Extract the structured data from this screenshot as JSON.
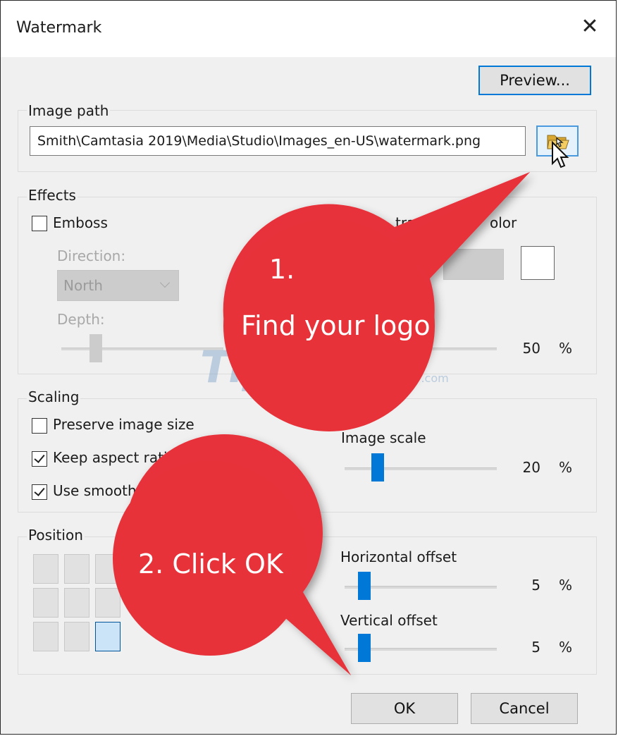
{
  "window": {
    "title": "Watermark",
    "close_glyph": "✕"
  },
  "toolbar": {
    "preview_label": "Preview..."
  },
  "image_path": {
    "group_label": "Image path",
    "value": "Smith\\Camtasia 2019\\Media\\Studio\\Images_en-US\\watermark.png",
    "browse_icon": "folder-open-icon"
  },
  "effects": {
    "group_label": "Effects",
    "emboss_label": "Emboss",
    "emboss_checked": false,
    "direction_label": "Direction:",
    "direction_value": "North",
    "depth_label": "Depth:",
    "transparent_color_label_visible": "trans",
    "transparent_color_label_visible_2": "olor",
    "opacity_value": "50",
    "percent": "%"
  },
  "scaling": {
    "group_label": "Scaling",
    "preserve_label": "Preserve image size",
    "preserve_checked": false,
    "aspect_label": "Keep aspect ratio",
    "aspect_checked": true,
    "smooth_label": "Use smooth",
    "smooth_checked": true,
    "image_scale_label": "Image scale",
    "image_scale_value": "20",
    "image_scale_fraction": 0.2,
    "percent": "%"
  },
  "position": {
    "group_label": "Position",
    "selected_cell": "bottom-right",
    "horizontal_label": "Horizontal offset",
    "horizontal_value": "5",
    "horizontal_fraction": 0.05,
    "vertical_label": "Vertical offset",
    "vertical_value": "5",
    "vertical_fraction": 0.05,
    "percent": "%"
  },
  "footer": {
    "ok_label": "OK",
    "cancel_label": "Cancel"
  },
  "annotations": {
    "step1_number": "1.",
    "step1_text": "Find your logo",
    "step2_text": "2. Click OK",
    "callout_color": "#e8323a"
  },
  "watermark": {
    "brand": "TipsMake",
    "suffix": ".com"
  },
  "colors": {
    "accent": "#0078d7",
    "dialog_bg": "#f0f0f0"
  }
}
